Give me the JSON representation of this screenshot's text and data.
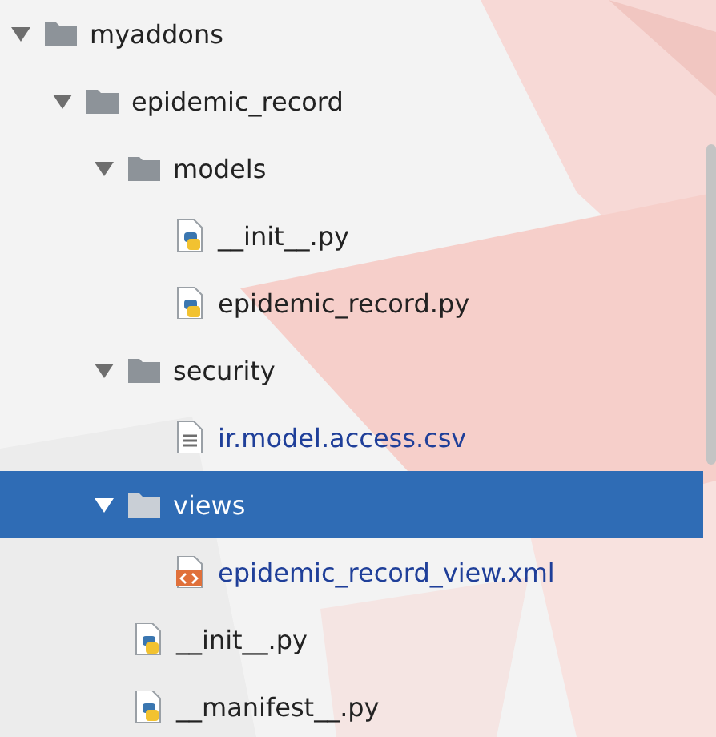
{
  "tree": [
    {
      "label": "myaddons",
      "kind": "folder",
      "expanded": true,
      "selected": false,
      "children": [
        {
          "label": "epidemic_record",
          "kind": "folder",
          "expanded": true,
          "selected": false,
          "children": [
            {
              "label": "models",
              "kind": "folder",
              "expanded": true,
              "selected": false,
              "children": [
                {
                  "label": "__init__.py",
                  "kind": "python",
                  "selected": false,
                  "color": "#222222"
                },
                {
                  "label": "epidemic_record.py",
                  "kind": "python",
                  "selected": false,
                  "color": "#222222"
                }
              ]
            },
            {
              "label": "security",
              "kind": "folder",
              "expanded": true,
              "selected": false,
              "children": [
                {
                  "label": "ir.model.access.csv",
                  "kind": "text",
                  "selected": false,
                  "color": "#1f3f99"
                }
              ]
            },
            {
              "label": "views",
              "kind": "folder",
              "expanded": true,
              "selected": true,
              "children": [
                {
                  "label": "epidemic_record_view.xml",
                  "kind": "xml",
                  "selected": false,
                  "color": "#1f3f99"
                }
              ]
            },
            {
              "label": "__init__.py",
              "kind": "python",
              "selected": false,
              "color": "#222222"
            },
            {
              "label": "__manifest__.py",
              "kind": "python",
              "selected": false,
              "color": "#222222"
            }
          ]
        }
      ]
    }
  ]
}
